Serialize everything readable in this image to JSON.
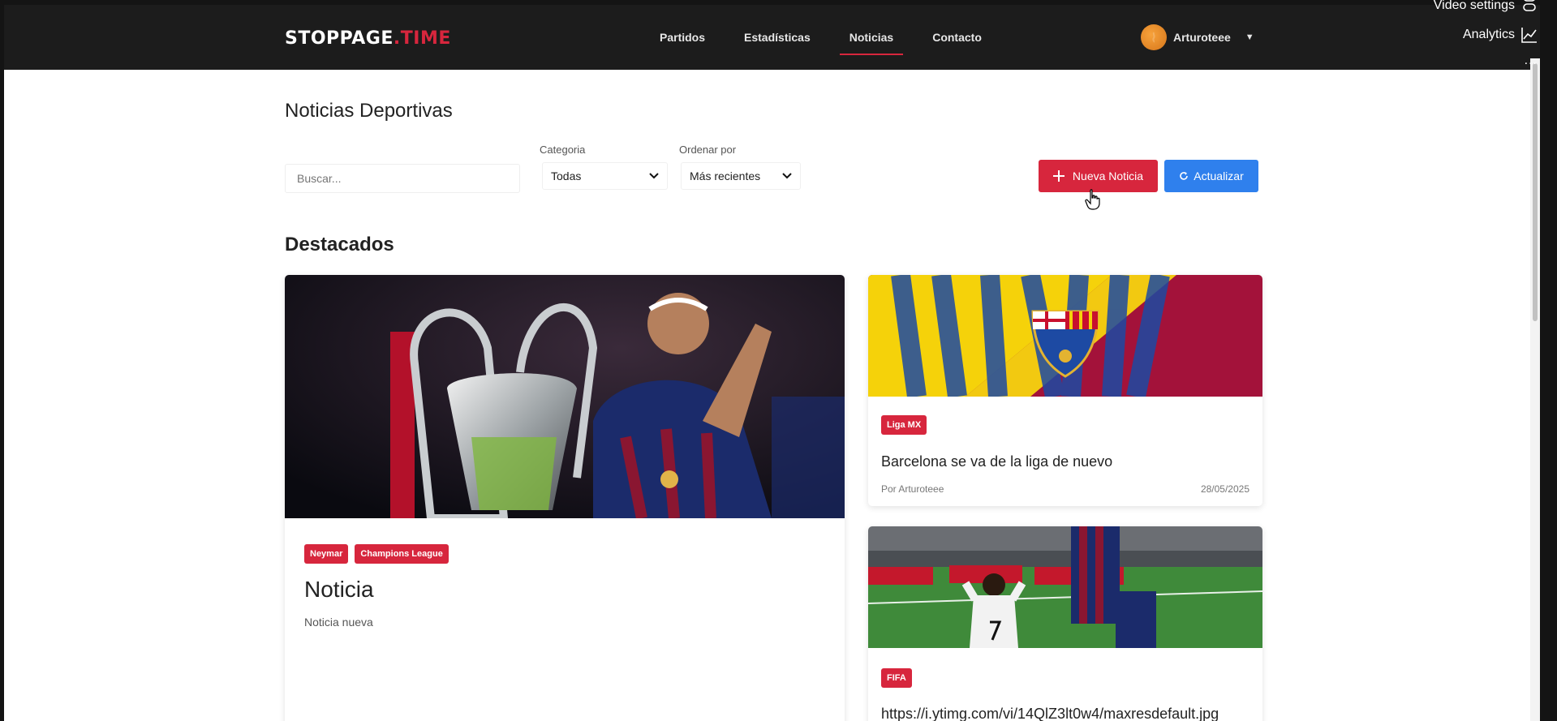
{
  "brand": {
    "name_main": "STOPPAGE",
    "name_dot": ".",
    "name_accent": "TIME"
  },
  "nav": {
    "links": [
      "Partidos",
      "Estadísticas",
      "Noticias",
      "Contacto"
    ],
    "active": "Noticias"
  },
  "user": {
    "name": "Arturoteee",
    "caret": "▼"
  },
  "overlay": {
    "video_settings": "Video settings",
    "analytics": "Analytics",
    "more": "..."
  },
  "page": {
    "title": "Noticias Deportivas"
  },
  "filters": {
    "search_placeholder": "Buscar...",
    "category_label": "Categoria",
    "category_value": "Todas",
    "sort_label": "Ordenar por",
    "sort_value": "Más recientes"
  },
  "actions": {
    "new_label": "Nueva Noticia",
    "refresh_label": "Actualizar"
  },
  "featured": {
    "title": "Destacados",
    "main": {
      "tags": [
        "Neymar",
        "Champions League"
      ],
      "headline": "Noticia",
      "summary": "Noticia nueva"
    },
    "side": [
      {
        "tag": "Liga MX",
        "headline": "Barcelona se va de la liga de nuevo",
        "author": "Por Arturoteee",
        "date": "28/05/2025"
      },
      {
        "tag": "FIFA",
        "headline": "https://i.ytimg.com/vi/14QlZ3lt0w4/maxresdefault.jpg"
      }
    ]
  },
  "colors": {
    "accent": "#d7263d",
    "primary": "#2f80ed",
    "navbar": "#1c1c1c"
  }
}
